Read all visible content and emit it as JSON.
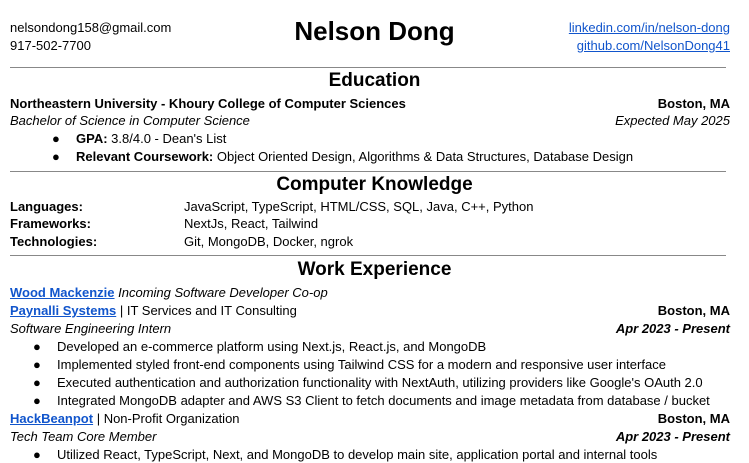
{
  "contact": {
    "email": "nelsondong158@gmail.com",
    "phone": "917-502-7700",
    "linkedin": "linkedin.com/in/nelson-dong",
    "github": "github.com/NelsonDong41"
  },
  "name": "Nelson Dong",
  "education": {
    "title": "Education",
    "school": "Northeastern University - Khoury College of Computer Sciences",
    "location": "Boston, MA",
    "degree": "Bachelor of Science in Computer Science",
    "expected": "Expected May 2025",
    "gpa_label": "GPA:",
    "gpa_value": "3.8/4.0 - Dean's List",
    "coursework_label": "Relevant Coursework:",
    "coursework_value": "Object Oriented Design, Algorithms & Data Structures, Database Design"
  },
  "knowledge": {
    "title": "Computer Knowledge",
    "rows": [
      {
        "label": "Languages:",
        "value": "JavaScript, TypeScript, HTML/CSS, SQL, Java, C++, Python"
      },
      {
        "label": "Frameworks:",
        "value": "NextJs, React, Tailwind"
      },
      {
        "label": "Technologies:",
        "value": "Git, MongoDB, Docker, ngrok"
      }
    ]
  },
  "work": {
    "title": "Work Experience",
    "wood": {
      "company": "Wood Mackenzie",
      "role": "Incoming Software Developer Co-op"
    },
    "paynalli": {
      "company": "Paynalli Systems",
      "desc": "| IT Services and IT Consulting",
      "location": "Boston, MA",
      "role": "Software Engineering Intern",
      "dates": "Apr 2023 - Present",
      "bullets": [
        "Developed an e-commerce platform using Next.js, React.js, and MongoDB",
        "Implemented styled front-end components using Tailwind CSS for a modern and responsive user interface",
        "Executed authentication and authorization functionality with NextAuth, utilizing providers like Google's OAuth 2.0",
        "Integrated MongoDB adapter and AWS S3 Client to fetch documents and image metadata from database / bucket"
      ]
    },
    "hackbeanpot": {
      "company": "HackBeanpot",
      "desc": "| Non-Profit Organization",
      "location": "Boston, MA",
      "role": "Tech Team Core Member",
      "dates": "Apr 2023 - Present",
      "bullets": [
        "Utilized React, TypeScript, Next, and MongoDB to develop main site, application portal and internal tools"
      ]
    }
  },
  "bullet_glyph": "●"
}
